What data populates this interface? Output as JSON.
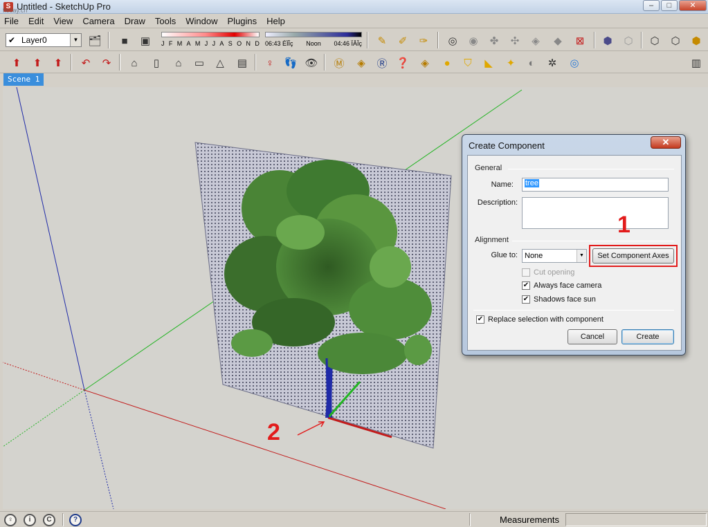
{
  "window": {
    "title": "Untitled - SketchUp Pro",
    "watermark": "fleday.cn",
    "minimize": "–",
    "maximize": "□",
    "close": "✕"
  },
  "menu": [
    "File",
    "Edit",
    "View",
    "Camera",
    "Draw",
    "Tools",
    "Window",
    "Plugins",
    "Help"
  ],
  "layers": {
    "current": "Layer0"
  },
  "shadows": {
    "months": [
      "J",
      "F",
      "M",
      "A",
      "M",
      "J",
      "J",
      "A",
      "S",
      "O",
      "N",
      "D"
    ],
    "time_start": "06:43 ÉÏÎç",
    "time_noon": "Noon",
    "time_end": "04:46 ÏÂÎç"
  },
  "scene_tab": "Scene 1",
  "dialog": {
    "title": "Create Component",
    "close_label": "✕",
    "general_label": "General",
    "name_label": "Name:",
    "name_value": "tree",
    "description_label": "Description:",
    "description_value": "",
    "alignment_label": "Alignment",
    "glue_label": "Glue to:",
    "glue_value": "None",
    "set_axes_label": "Set Component Axes",
    "cut_opening_label": "Cut opening",
    "always_face_camera_label": "Always face camera",
    "shadows_face_sun_label": "Shadows face sun",
    "replace_selection_label": "Replace selection with component",
    "cancel_label": "Cancel",
    "create_label": "Create",
    "cut_opening_checked": false,
    "always_face_camera_checked": true,
    "shadows_face_sun_checked": true,
    "replace_selection_checked": true
  },
  "annotations": {
    "one": "1",
    "two": "2"
  },
  "status": {
    "measurements_label": "Measurements",
    "measurements_value": ""
  },
  "colors": {
    "red_axis": "#c21a1a",
    "green_axis": "#22b422",
    "blue_axis": "#1f2aa8",
    "annotation": "#e21b1b",
    "scene_tab": "#3a8edc"
  }
}
